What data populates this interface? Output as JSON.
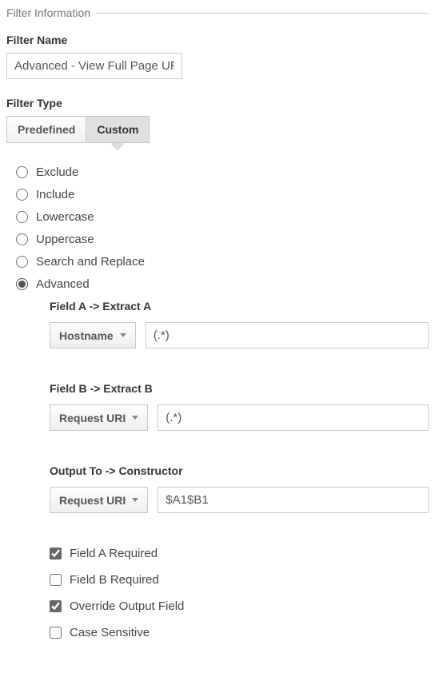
{
  "section": {
    "title": "Filter Information"
  },
  "filter_name": {
    "label": "Filter Name",
    "value": "Advanced - View Full Page URL (I"
  },
  "filter_type": {
    "label": "Filter Type",
    "tabs": {
      "predefined": "Predefined",
      "custom": "Custom"
    },
    "active": "custom"
  },
  "type_options": {
    "exclude": "Exclude",
    "include": "Include",
    "lowercase": "Lowercase",
    "uppercase": "Uppercase",
    "search_replace": "Search and Replace",
    "advanced": "Advanced",
    "selected": "advanced"
  },
  "advanced": {
    "fieldA": {
      "label": "Field A -> Extract A",
      "select": "Hostname",
      "pattern": "(.*)"
    },
    "fieldB": {
      "label": "Field B -> Extract B",
      "select": "Request URI",
      "pattern": "(.*)"
    },
    "output": {
      "label": "Output To -> Constructor",
      "select": "Request URI",
      "pattern": "$A1$B1"
    },
    "checks": {
      "field_a_required": {
        "label": "Field A Required",
        "checked": true
      },
      "field_b_required": {
        "label": "Field B Required",
        "checked": false
      },
      "override_output": {
        "label": "Override Output Field",
        "checked": true
      },
      "case_sensitive": {
        "label": "Case Sensitive",
        "checked": false
      }
    }
  }
}
